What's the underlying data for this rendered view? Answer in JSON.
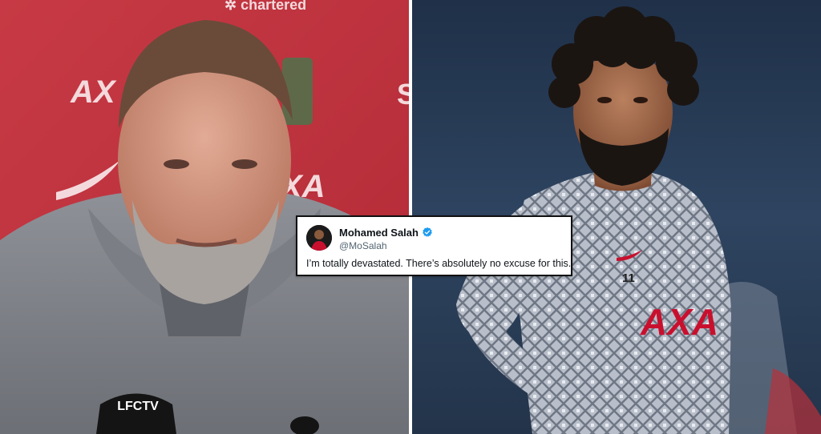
{
  "tweet": {
    "name": "Mohamed Salah",
    "handle": "@MoSalah",
    "text": "I’m totally devastated. There’s absolutely no excuse for this.",
    "verified_color": "#1d9bf0"
  },
  "left_photo": {
    "mic_label": "LFCTV",
    "backdrop_color": "#c8323d"
  },
  "right_photo": {
    "shirt_number": "11",
    "sponsor": "AXA",
    "backdrop_color": "#2a3a4e"
  }
}
